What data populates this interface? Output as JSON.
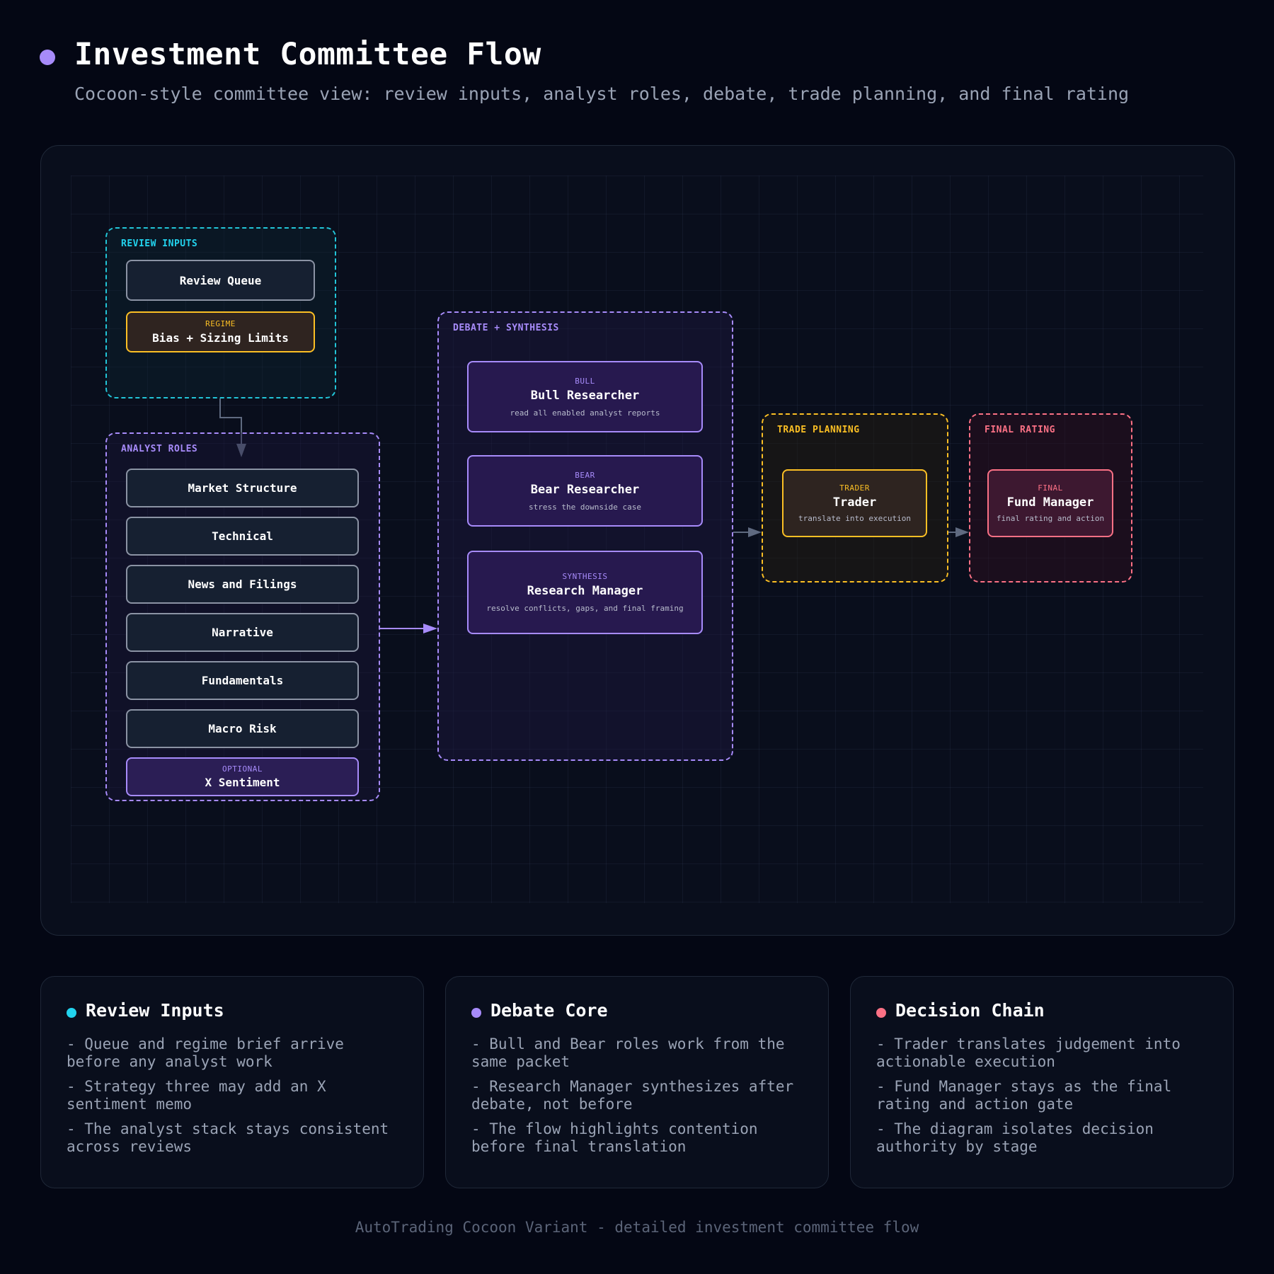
{
  "header": {
    "title": "Investment Committee Flow",
    "subtitle": "Cocoon-style committee view: review inputs, analyst roles, debate, trade planning, and final rating"
  },
  "colors": {
    "background": "#040714",
    "cyan": "#22d3ee",
    "purple": "#a78bfa",
    "amber": "#fbbf24",
    "rose": "#fb7185"
  },
  "diagram": {
    "review_inputs": {
      "label": "REVIEW INPUTS",
      "review_queue": "Review Queue",
      "regime_tag": "REGIME",
      "regime_title": "Bias + Sizing Limits"
    },
    "analyst_roles": {
      "label": "ANALYST ROLES",
      "items": [
        "Market Structure",
        "Technical",
        "News and Filings",
        "Narrative",
        "Fundamentals",
        "Macro Risk"
      ],
      "optional_tag": "OPTIONAL",
      "optional_title": "X Sentiment"
    },
    "debate": {
      "label": "DEBATE + SYNTHESIS",
      "bull": {
        "tag": "BULL",
        "title": "Bull Researcher",
        "desc": "read all enabled analyst reports"
      },
      "bear": {
        "tag": "BEAR",
        "title": "Bear Researcher",
        "desc": "stress the downside case"
      },
      "manager": {
        "tag": "SYNTHESIS",
        "title": "Research Manager",
        "desc": "resolve conflicts, gaps, and final framing"
      }
    },
    "trade_planning": {
      "label": "TRADE PLANNING",
      "tag": "TRADER",
      "title": "Trader",
      "desc": "translate into execution"
    },
    "final_rating": {
      "label": "FINAL RATING",
      "tag": "FINAL",
      "title": "Fund Manager",
      "desc": "final rating and action"
    }
  },
  "cards": [
    {
      "title": "Review Inputs",
      "dot_color": "#22d3ee",
      "items": [
        "- Queue and regime brief arrive before any analyst work",
        "- Strategy three may add an X sentiment memo",
        "- The analyst stack stays consistent across reviews"
      ]
    },
    {
      "title": "Debate Core",
      "dot_color": "#a78bfa",
      "items": [
        "- Bull and Bear roles work from the same packet",
        "- Research Manager synthesizes after debate, not before",
        "- The flow highlights contention before final translation"
      ]
    },
    {
      "title": "Decision Chain",
      "dot_color": "#fb7185",
      "items": [
        "- Trader translates judgement into actionable execution",
        "- Fund Manager stays as the final rating and action gate",
        "- The diagram isolates decision authority by stage"
      ]
    }
  ],
  "footer": "AutoTrading Cocoon Variant - detailed investment committee flow"
}
